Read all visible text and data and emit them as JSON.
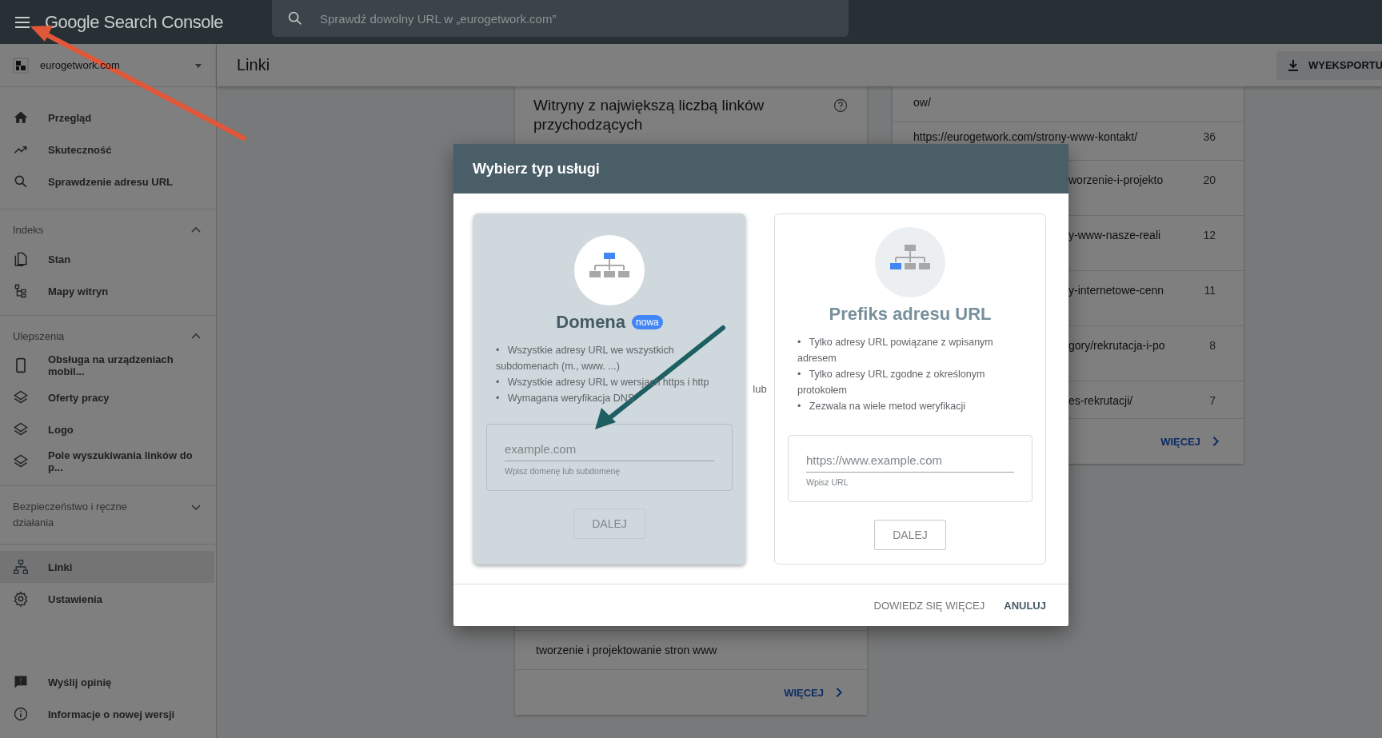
{
  "header": {
    "app_name": "Google Search Console",
    "search": {
      "placeholder": "Sprawdź dowolny URL w „eurogetwork.com”"
    }
  },
  "property": {
    "name": "eurogetwork.com"
  },
  "sidebar": {
    "top_items": [
      {
        "label": "Przegląd",
        "kind": "home",
        "selected": false
      },
      {
        "label": "Skuteczność",
        "kind": "trend",
        "selected": false
      },
      {
        "label": "Sprawdzenie adresu URL",
        "kind": "search",
        "selected": false
      }
    ],
    "sections": [
      {
        "title": "Indeks",
        "expanded": true,
        "items": [
          {
            "label": "Stan",
            "kind": "pages",
            "selected": false
          },
          {
            "label": "Mapy witryn",
            "kind": "sitemap",
            "selected": false
          }
        ]
      },
      {
        "title": "Ulepszenia",
        "expanded": true,
        "items": [
          {
            "label": "Obsługa na urządzeniach mobil...",
            "kind": "phone",
            "selected": false
          },
          {
            "label": "Oferty pracy",
            "kind": "layers",
            "selected": false
          },
          {
            "label": "Logo",
            "kind": "layers",
            "selected": false
          },
          {
            "label": "Pole wyszukiwania linków do p...",
            "kind": "layers",
            "selected": false
          }
        ]
      },
      {
        "title": "Bezpieczeństwo i ręczne działania",
        "expanded": false
      }
    ],
    "main_items": [
      {
        "label": "Linki",
        "kind": "network",
        "selected": true
      },
      {
        "label": "Ustawienia",
        "kind": "gear",
        "selected": false
      }
    ],
    "bottom_items": [
      {
        "label": "Wyślij opinię",
        "kind": "feedback",
        "selected": false
      },
      {
        "label": "Informacje o nowej wersji",
        "kind": "info",
        "selected": false
      }
    ]
  },
  "page": {
    "title": "Linki",
    "export_button": "WYEKSPORTU"
  },
  "left_card": {
    "title": "Witryny z największą liczbą linków przychodzących",
    "rows": [
      "tworzenie i projektowanie stron www"
    ],
    "more": "WIĘCEJ"
  },
  "right_card": {
    "rows": [
      {
        "url": "ow/"
      },
      {
        "url": "https://eurogetwork.com/strony-www-kontakt/",
        "count": "36"
      },
      {
        "url": "worzenie-i-projekto",
        "count": "20"
      },
      {
        "url": "y-www-nasze-reali",
        "count": "12"
      },
      {
        "url": "y-internetowe-cenn",
        "count": "11"
      },
      {
        "url": "gory/rekrutacja-i-po",
        "count": "8"
      },
      {
        "url": "es-rekrutacji/",
        "count": "7"
      }
    ],
    "more": "WIĘCEJ"
  },
  "dialog": {
    "title": "Wybierz typ usługi",
    "separator": "lub",
    "options": [
      {
        "title": "Domena",
        "badge": "nowa",
        "selected": true,
        "bullets": [
          {
            "marker": "•",
            "text": "Wszystkie adresy URL we wszystkich subdomenach (m., www. ...)"
          },
          {
            "marker": "•",
            "text": "Wszystkie adresy URL w wersjach https i http"
          },
          {
            "marker": "•",
            "text": "Wymagana weryfikacja DNS"
          }
        ],
        "placeholder": "example.com",
        "helper": "Wpisz domenę lub subdomenę",
        "button": "DALEJ",
        "disabled": true
      },
      {
        "title": "Prefiks adresu URL",
        "selected": false,
        "bullets": [
          {
            "marker": "•",
            "text": "Tylko adresy URL powiązane z wpisanym adresem"
          },
          {
            "marker": "•",
            "text": "Tylko adresy URL zgodne z określonym protokołem"
          },
          {
            "marker": "•",
            "text": "Zezwala na wiele metod weryfikacji"
          }
        ],
        "placeholder": "https://www.example.com",
        "helper": "Wpisz URL",
        "button": "DALEJ",
        "disabled": true
      }
    ],
    "buttons": [
      {
        "label": "DOWIEDZ SIĘ WIĘCEJ",
        "kind": "secondary"
      },
      {
        "label": "ANULUJ",
        "kind": "primary"
      }
    ]
  },
  "annotations": [
    {
      "color": "#e0573a"
    },
    {
      "color": "#1d5f63"
    }
  ]
}
